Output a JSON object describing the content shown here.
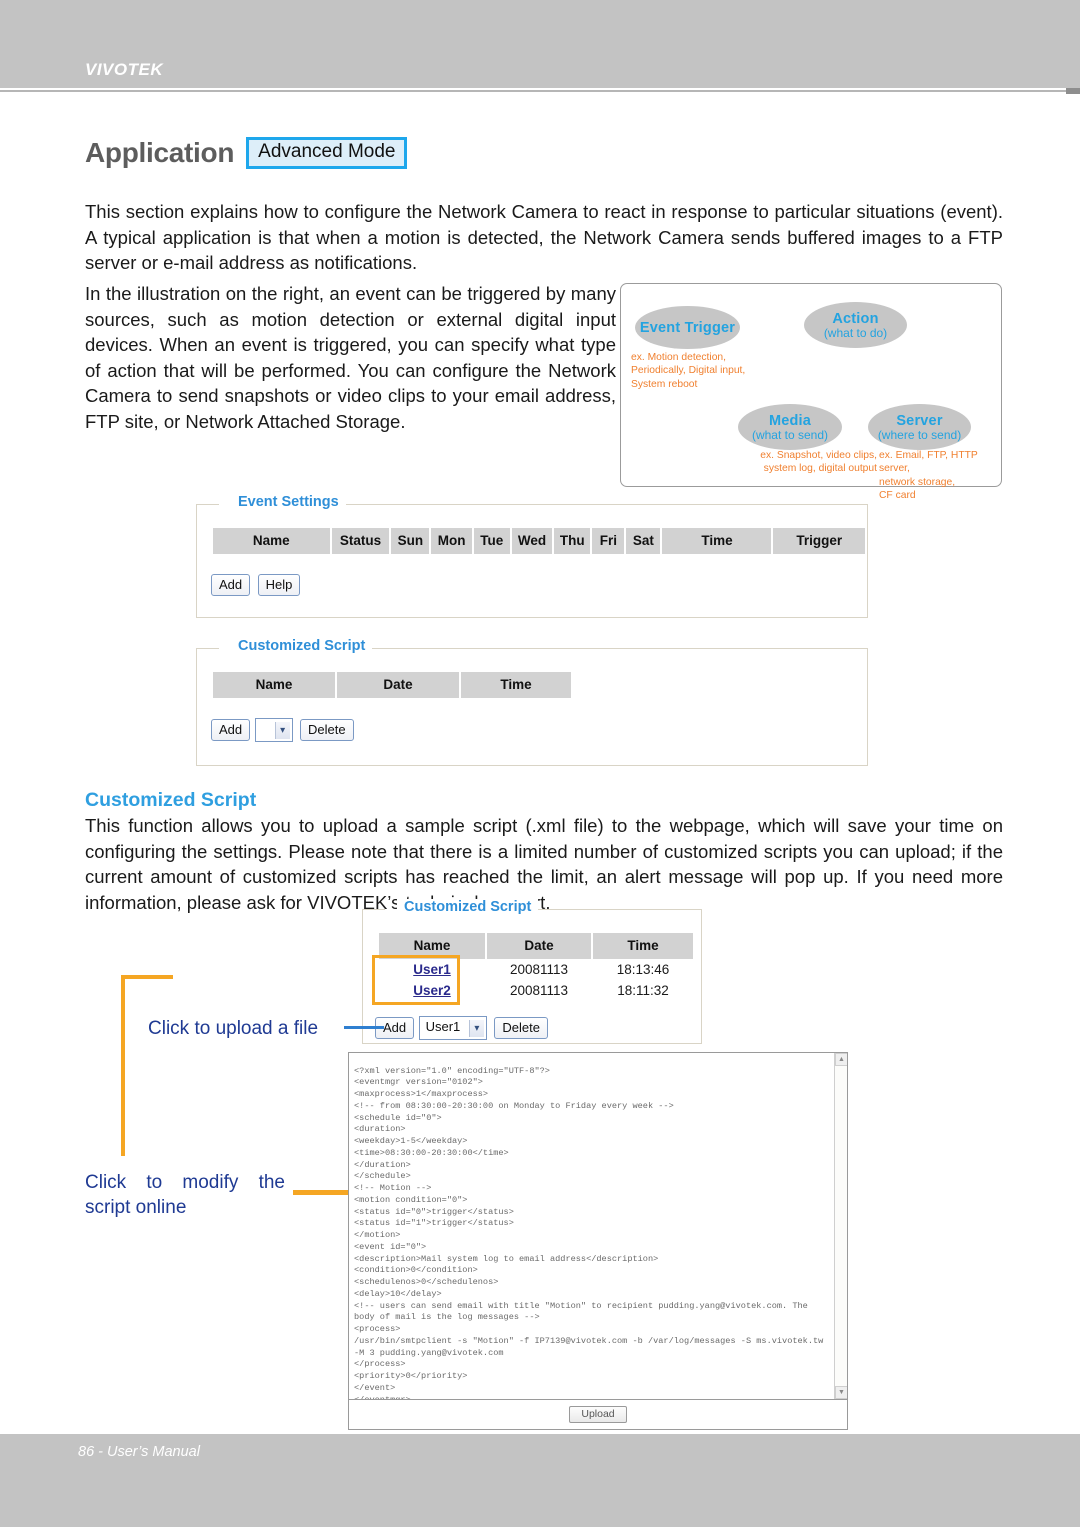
{
  "header": {
    "brand": "VIVOTEK"
  },
  "title": {
    "text": "Application",
    "badge": "Advanced Mode"
  },
  "paragraphs": {
    "intro": "This section explains how to configure the Network Camera to react in response to particular situations (event). A typical application is that when a motion is detected, the Network Camera sends buffered images to a FTP server or e-mail address as notifications.",
    "illustration": "In the illustration on the right, an event can be triggered by many sources, such as motion detection or external digital input devices. When an event is triggered, you can specify what type of action that will be performed. You can configure the Network Camera to send snapshots or video clips to your email address, FTP site, or  Network Attached Storage.",
    "customized_script": "This function allows you to upload a sample script (.xml file) to the webpage, which will save your time on configuring the settings. Please note that there is a limited number of customized scripts you can upload; if the current amount of customized scripts has reached the limit, an alert message will pop up. If you need more information, please ask for VIVOTEK’s technical support."
  },
  "illustration": {
    "nodes": [
      {
        "title": "Event Trigger",
        "sub": ""
      },
      {
        "title": "Action",
        "sub": "(what to do)"
      },
      {
        "title": "Media",
        "sub": "(what to send)"
      },
      {
        "title": "Server",
        "sub": "(where to send)"
      }
    ],
    "examples": {
      "trigger": "ex. Motion detection,\n     Periodically, Digital input,\n     System reboot",
      "media": "ex. Snapshot, video clips,\nsystem log, digital output",
      "server": "ex. Email, FTP, HTTP server,\n      network storage,\n      CF card"
    },
    "colors": {
      "node_text": "#23a3e0",
      "node_fill": "#c6c6c6",
      "example_text": "#f08030"
    }
  },
  "event_settings": {
    "legend": "Event Settings",
    "columns": [
      "Name",
      "Status",
      "Sun",
      "Mon",
      "Tue",
      "Wed",
      "Thu",
      "Fri",
      "Sat",
      "Time",
      "Trigger"
    ],
    "rows": [],
    "buttons": [
      "Add",
      "Help"
    ]
  },
  "customized_script_empty": {
    "legend": "Customized Script",
    "columns": [
      "Name",
      "Date",
      "Time"
    ],
    "rows": [],
    "add_label": "Add",
    "delete_label": "Delete",
    "select_value": "",
    "select_arrow": "▾"
  },
  "section_heading": "Customized Script",
  "customized_script_filled": {
    "legend": "Customized Script",
    "columns": [
      "Name",
      "Date",
      "Time"
    ],
    "rows": [
      {
        "name": "User1",
        "date": "20081113",
        "time": "18:13:46"
      },
      {
        "name": "User2",
        "date": "20081113",
        "time": "18:11:32"
      }
    ],
    "add_label": "Add",
    "delete_label": "Delete",
    "select_value": "User1",
    "select_arrow": "▾"
  },
  "callouts": {
    "upload": "Click to upload a file",
    "modify": "Click to modify the script online",
    "highlight_color": "#f5a623",
    "text_color": "#1f3a93"
  },
  "script_box": {
    "code": "<?xml version=\"1.0\" encoding=\"UTF-8\"?>\n<eventmgr version=\"0102\">\n<maxprocess>1</maxprocess>\n<!-- from 08:30:00-20:30:00 on Monday to Friday every week -->\n<schedule id=\"0\">\n<duration>\n<weekday>1-5</weekday>\n<time>08:30:00-20:30:00</time>\n</duration>\n</schedule>\n<!-- Motion -->\n<motion condition=\"0\">\n<status id=\"0\">trigger</status>\n<status id=\"1\">trigger</status>\n</motion>\n<event id=\"0\">\n<description>Mail system log to email address</description>\n<condition>0</condition>\n<schedulenos>0</schedulenos>\n<delay>10</delay>\n<!-- users can send email with title \"Motion\" to recipient pudding.yang@vivotek.com. The body of mail is the log messages -->\n<process>\n/usr/bin/smtpclient -s \"Motion\" -f IP7139@vivotek.com -b /var/log/messages -S ms.vivotek.tw -M 3 pudding.yang@vivotek.com\n</process>\n<priority>0</priority>\n</event>\n</eventmgr>",
    "upload_button": "Upload",
    "scroll_up": "▲",
    "scroll_down": "▼"
  },
  "footer": {
    "text": "86 - User’s Manual"
  }
}
